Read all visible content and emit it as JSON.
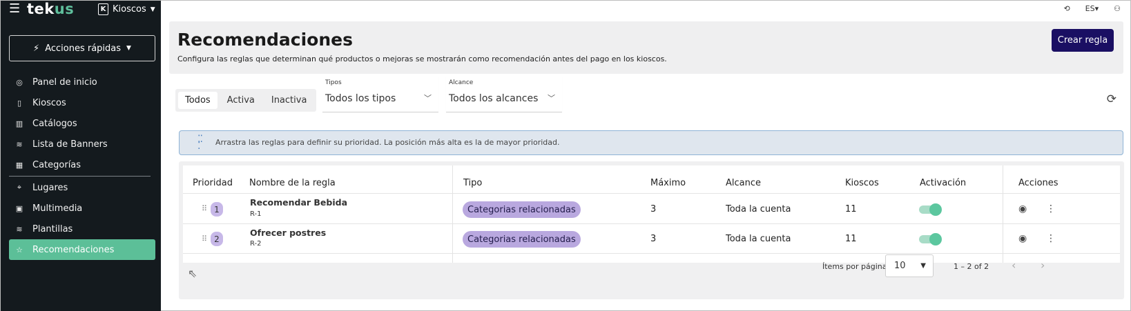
{
  "brand": {
    "logo_main": "tek",
    "logo_accent": "us",
    "workspace_badge": "K",
    "workspace": "Kioscos"
  },
  "sidebar": {
    "quick_actions": "Acciones rápidas",
    "items": [
      {
        "label": "Panel de inicio",
        "icon": "gauge-icon"
      },
      {
        "label": "Kioscos",
        "icon": "kiosk-icon"
      },
      {
        "label": "Catálogos",
        "icon": "book-icon"
      },
      {
        "label": "Lista de Banners",
        "icon": "layers-icon"
      },
      {
        "label": "Categorías",
        "icon": "boxes-icon"
      },
      {
        "label": "Lugares",
        "icon": "pin-icon"
      },
      {
        "label": "Multimedia",
        "icon": "image-icon"
      },
      {
        "label": "Plantillas",
        "icon": "layers-icon"
      },
      {
        "label": "Recomendaciones",
        "icon": "star-icon",
        "active": true
      }
    ]
  },
  "topbar": {
    "language": "ES"
  },
  "header": {
    "title": "Recomendaciones",
    "subtitle": "Configura las reglas que determinan qué productos o mejoras se mostrarán como recomendación antes del pago en los kioscos.",
    "create_label": "Crear regla"
  },
  "filters": {
    "status_tabs": [
      "Todos",
      "Activa",
      "Inactiva"
    ],
    "types_label": "Tipos",
    "types_value": "Todos los tipos",
    "scope_label": "Alcance",
    "scope_value": "Todos los alcances"
  },
  "banner": {
    "text": "Arrastra las reglas para definir su prioridad. La posición más alta es la de mayor prioridad."
  },
  "table": {
    "headers": [
      "Prioridad",
      "Nombre de la regla",
      "Tipo",
      "Máximo",
      "Alcance",
      "Kioscos",
      "Activación",
      "Acciones"
    ],
    "rows": [
      {
        "priority": "1",
        "name": "Recomendar Bebida",
        "code": "R-1",
        "type": "Categorias relacionadas",
        "max": "3",
        "scope": "Toda la cuenta",
        "kiosks": "11",
        "active": true
      },
      {
        "priority": "2",
        "name": "Ofrecer postres",
        "code": "R-2",
        "type": "Categorias relacionadas",
        "max": "3",
        "scope": "Toda la cuenta",
        "kiosks": "11",
        "active": true
      }
    ]
  },
  "pagination": {
    "items_label": "Ítems por página",
    "page_size": "10",
    "range": "1 – 2 of 2"
  },
  "colors": {
    "sidebar_bg": "#141a1e",
    "accent_green": "#5cbf98",
    "primary_btn": "#1a0f63",
    "chip": "#b9a8df"
  }
}
